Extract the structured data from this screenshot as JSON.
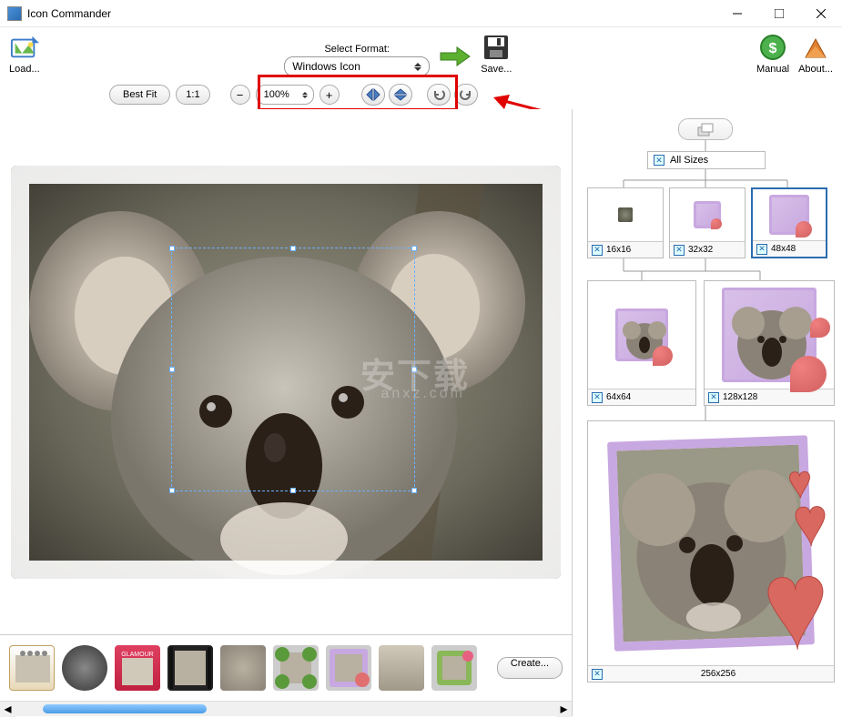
{
  "app": {
    "title": "Icon Commander"
  },
  "toolbar": {
    "load": "Load...",
    "format_label": "Select Format:",
    "format_value": "Windows Icon",
    "save": "Save...",
    "manual": "Manual",
    "about": "About..."
  },
  "zoom": {
    "best_fit": "Best Fit",
    "one_to_one": "1:1",
    "value": "100%"
  },
  "thumbs": {
    "create": "Create..."
  },
  "sizes": {
    "all": "All Sizes",
    "s16": "16x16",
    "s32": "32x32",
    "s48": "48x48",
    "s64": "64x64",
    "s128": "128x128",
    "s256": "256x256"
  },
  "watermark": {
    "line1": "安下载",
    "line2": "anxz.com"
  }
}
